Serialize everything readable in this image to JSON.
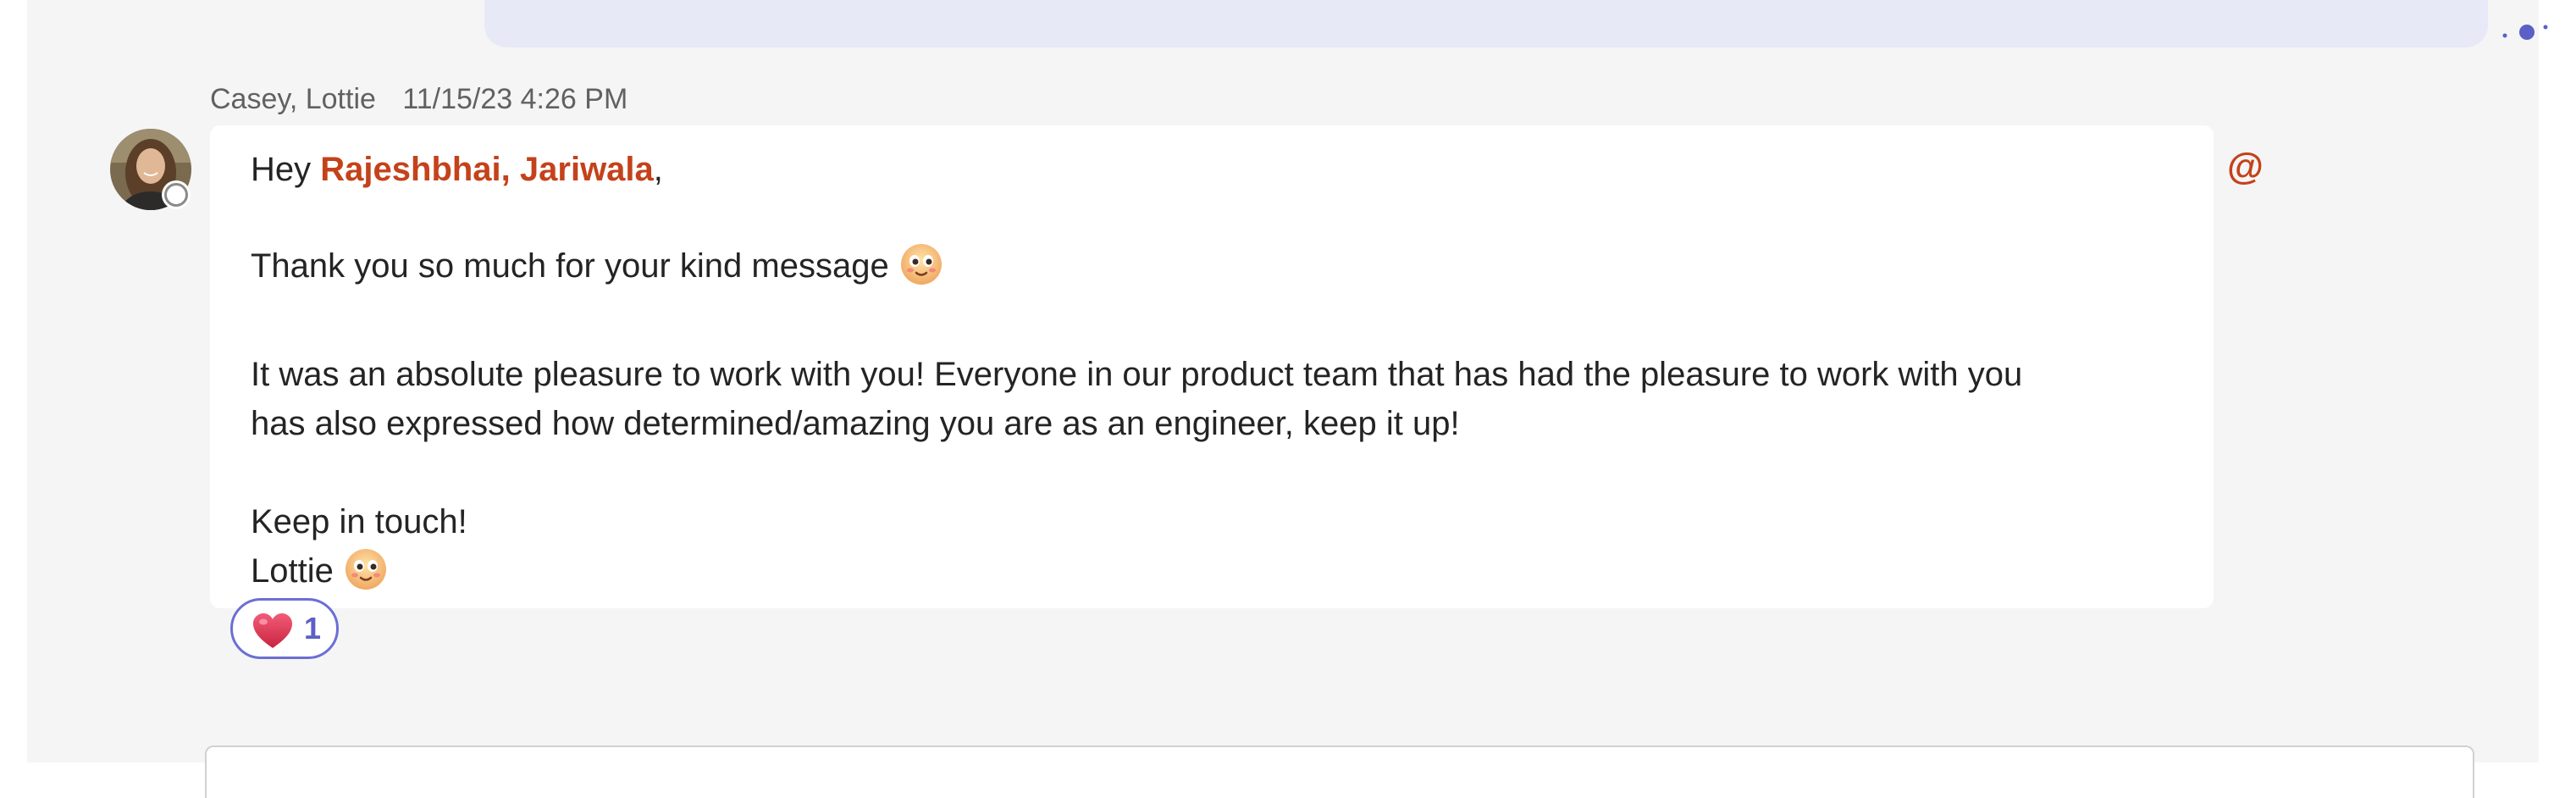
{
  "message": {
    "sender": "Casey, Lottie",
    "timestamp": "11/15/23 4:26 PM",
    "greeting": "Hey",
    "mention": "Rajeshbhai, Jariwala",
    "greeting_comma": ",",
    "line_thanks": "Thank you so much for your kind message",
    "line_body_1": "It was an absolute pleasure to work with you! Everyone in our product team that has had the pleasure to work with you",
    "line_body_2": "has also expressed how determined/amazing you are as an engineer, keep it up!",
    "line_keep": "Keep in touch!",
    "signature": "Lottie"
  },
  "mention_indicator": "@",
  "reaction": {
    "icon": "heart-icon",
    "count": "1"
  },
  "colors": {
    "mention": "#c4421a",
    "reaction_accent": "#5b5fc7",
    "chat_background": "#f5f5f5"
  }
}
